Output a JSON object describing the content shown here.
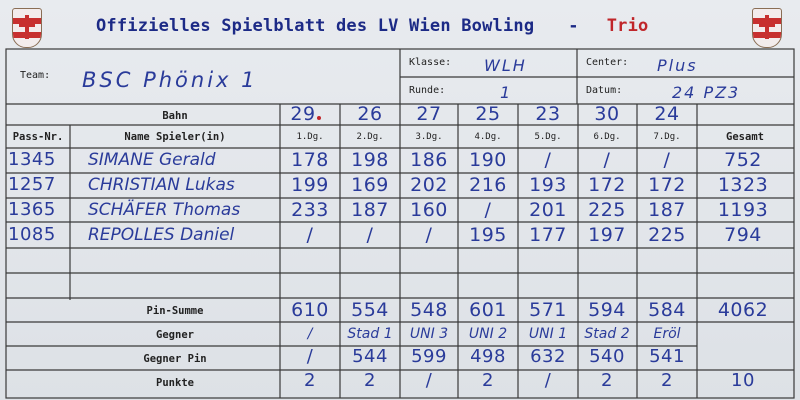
{
  "header": {
    "title": "Offizielles Spielblatt des LV Wien Bowling",
    "separator": "-",
    "variant": "Trio"
  },
  "info": {
    "team_label": "Team:",
    "team_value": "BSC Phönix 1",
    "klasse_label": "Klasse:",
    "klasse_value": "WLH",
    "center_label": "Center:",
    "center_value": "Plus",
    "runde_label": "Runde:",
    "runde_value": "1",
    "datum_label": "Datum:",
    "datum_value": "24 PZ3"
  },
  "table": {
    "bahn_label": "Bahn",
    "lanes": [
      "29",
      "26",
      "27",
      "25",
      "23",
      "30",
      "24"
    ],
    "col_pass": "Pass-Nr.",
    "col_name": "Name Spieler(in)",
    "col_games": [
      "1.Dg.",
      "2.Dg.",
      "3.Dg.",
      "4.Dg.",
      "5.Dg.",
      "6.Dg.",
      "7.Dg."
    ],
    "col_total": "Gesamt",
    "players": [
      {
        "pass": "1345",
        "name": "SIMANE Gerald",
        "scores": [
          "178",
          "198",
          "186",
          "190",
          "/",
          "/",
          "/"
        ],
        "total": "752"
      },
      {
        "pass": "1257",
        "name": "CHRISTIAN Lukas",
        "scores": [
          "199",
          "169",
          "202",
          "216",
          "193",
          "172",
          "172"
        ],
        "total": "1323"
      },
      {
        "pass": "1365",
        "name": "SCHÄFER Thomas",
        "scores": [
          "233",
          "187",
          "160",
          "/",
          "201",
          "225",
          "187"
        ],
        "total": "1193"
      },
      {
        "pass": "1085",
        "name": "REPOLLES Daniel",
        "scores": [
          "/",
          "/",
          "/",
          "195",
          "177",
          "197",
          "225"
        ],
        "total": "794"
      }
    ],
    "pin_summe_label": "Pin-Summe",
    "pin_summe": [
      "610",
      "554",
      "548",
      "601",
      "571",
      "594",
      "584"
    ],
    "pin_total": "4062",
    "gegner_label": "Gegner",
    "gegner": [
      "/",
      "Stad 1",
      "UNI 3",
      "UNI 2",
      "UNI 1",
      "Stad 2",
      "Eröl"
    ],
    "gegner_pin_label": "Gegner Pin",
    "gegner_pin": [
      "/",
      "544",
      "599",
      "498",
      "632",
      "540",
      "541"
    ],
    "punkte_label": "Punkte",
    "punkte": [
      "2",
      "2",
      "/",
      "2",
      "/",
      "2",
      "2"
    ],
    "punkte_total": "10"
  },
  "colors": {
    "title": "#1c2a86",
    "trio": "#c0262a",
    "ink": "#2a3b9a",
    "lines": "#3a3a3a"
  }
}
